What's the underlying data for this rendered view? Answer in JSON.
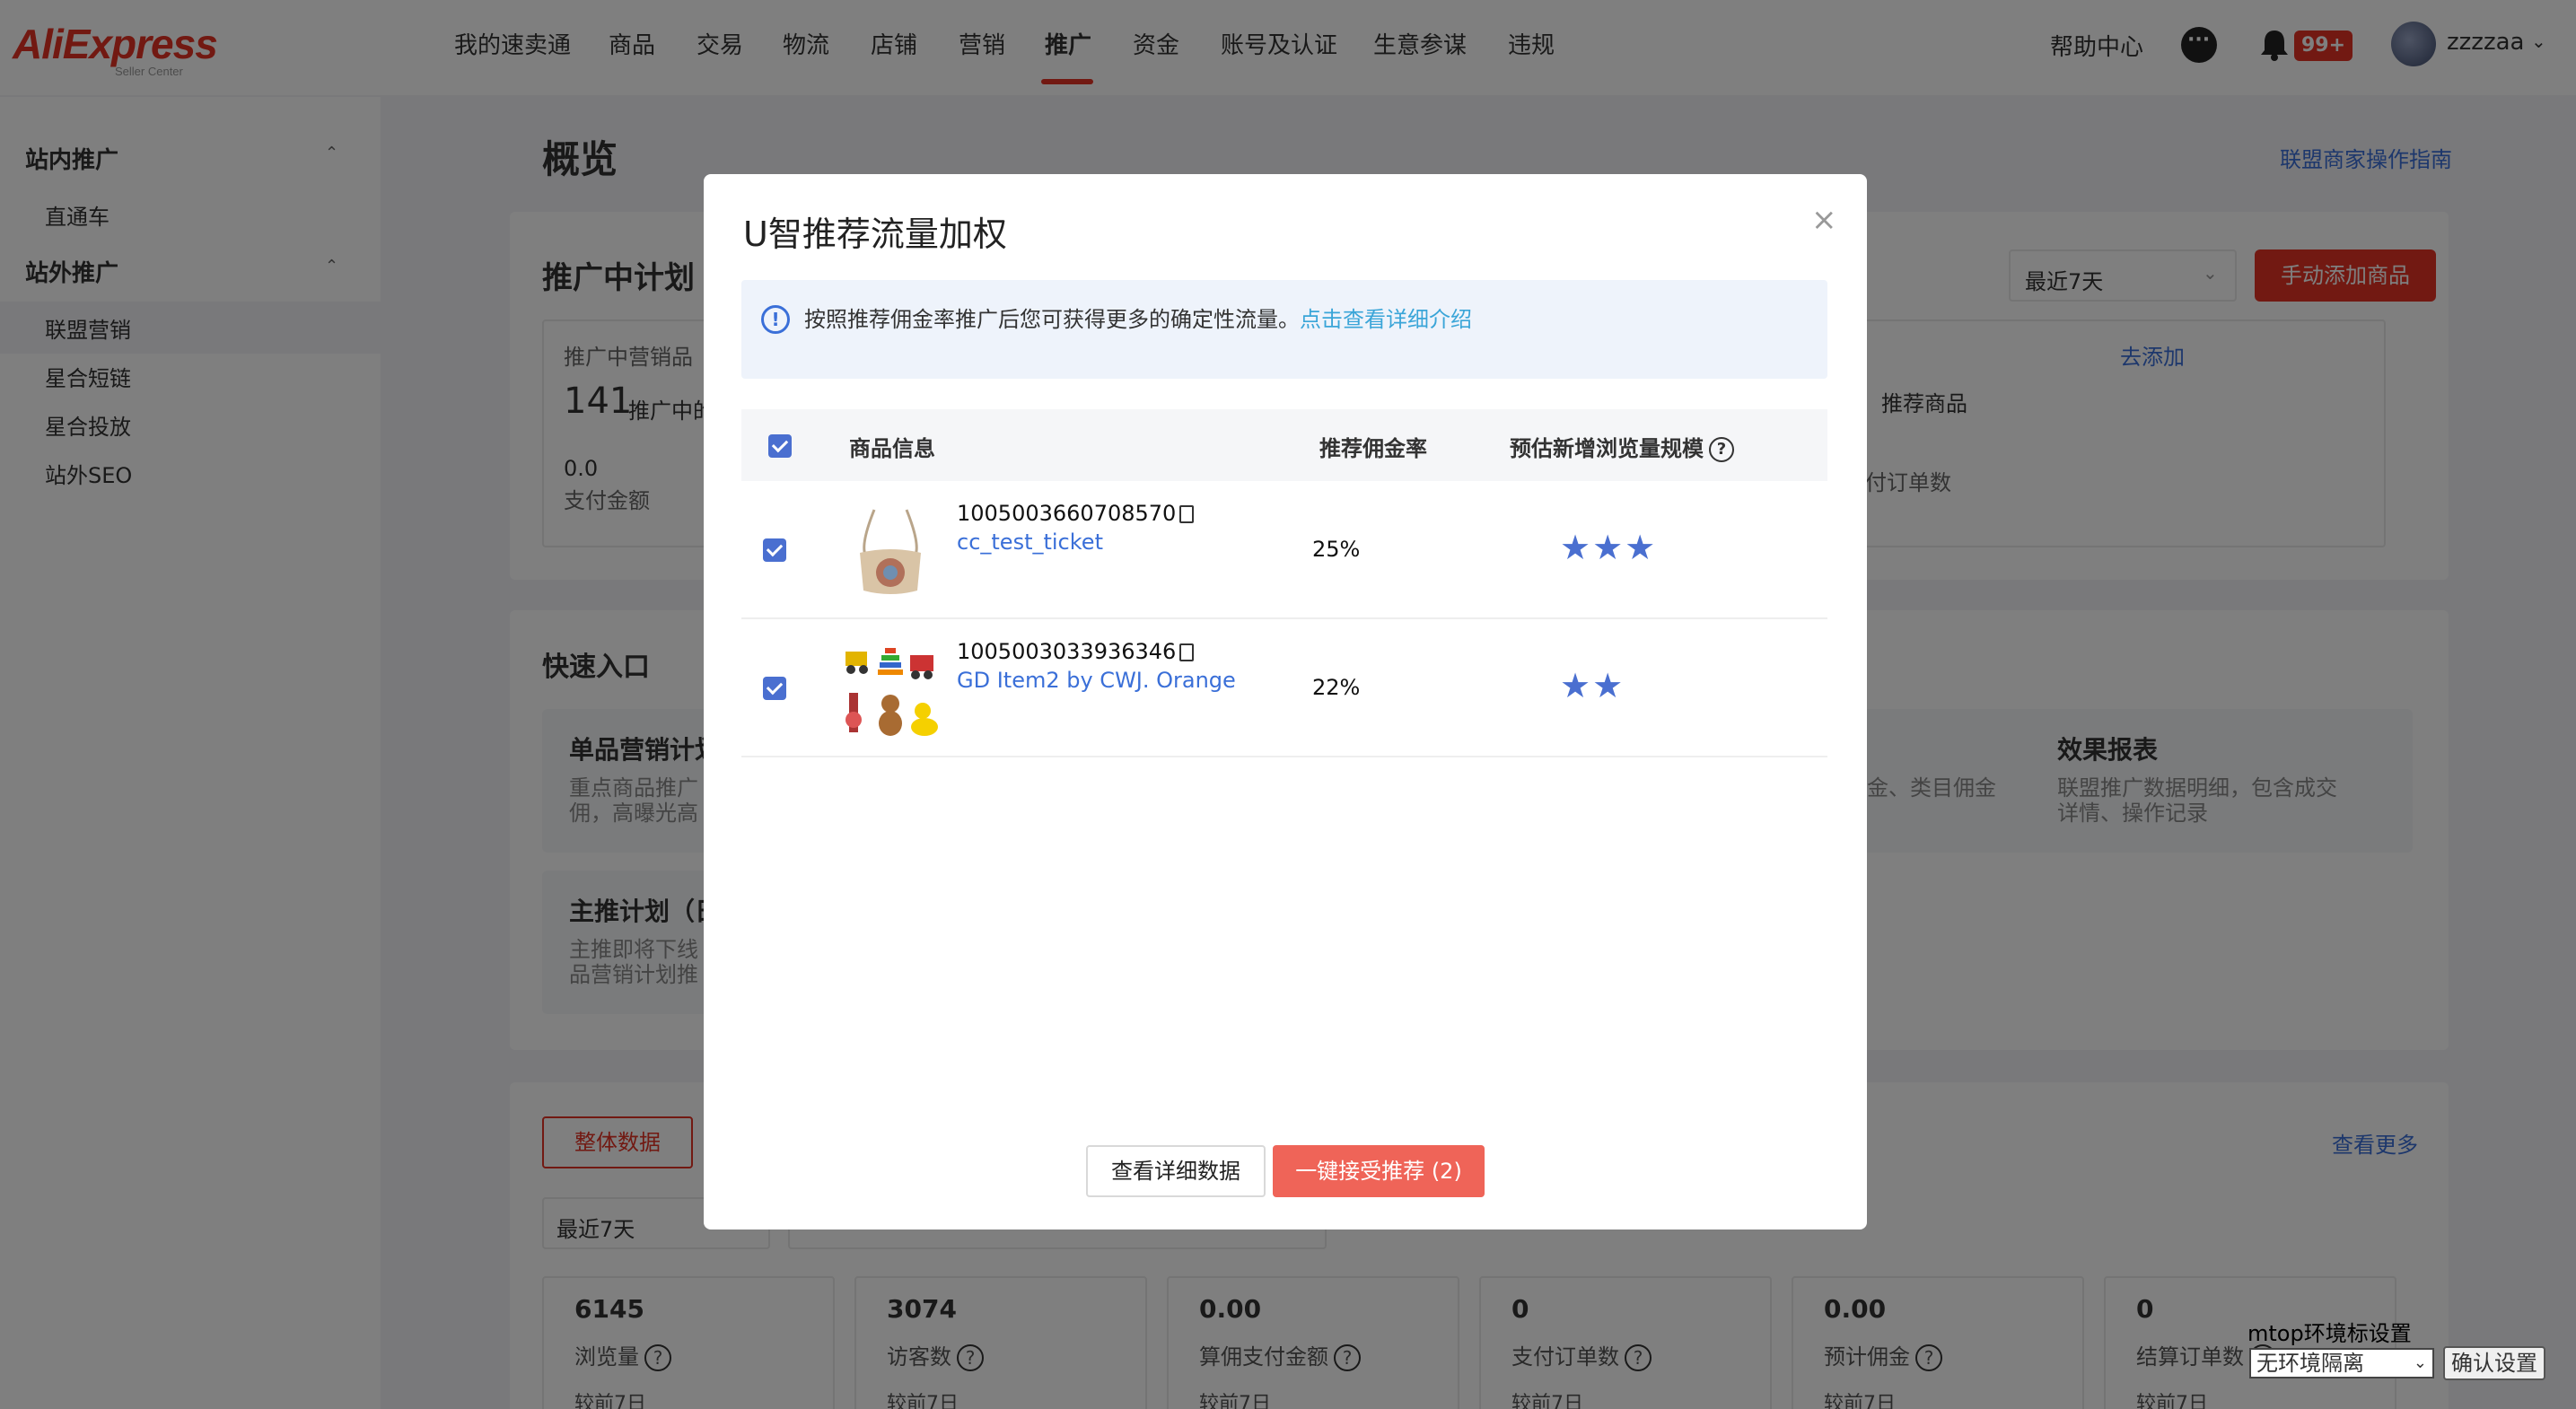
{
  "brand": {
    "logo_text": "AliExpress",
    "logo_sub": "Seller Center"
  },
  "nav": {
    "items": [
      "我的速卖通",
      "商品",
      "交易",
      "物流",
      "店铺",
      "营销",
      "推广",
      "资金",
      "账号及认证",
      "生意参谋",
      "违规"
    ],
    "active": "推广",
    "help": "帮助中心",
    "notification_badge": "99+",
    "username": "zzzzaa"
  },
  "sidebar": {
    "groups": [
      {
        "label": "站内推广",
        "items": [
          "直通车"
        ]
      },
      {
        "label": "站外推广",
        "items": [
          "联盟营销",
          "星合短链",
          "星合投放",
          "站外SEO"
        ]
      }
    ],
    "active_item": "联盟营销"
  },
  "page": {
    "title": "概览",
    "guide_link": "联盟商家操作指南",
    "promo": {
      "title": "推广中计划",
      "range_select": "最近7天",
      "add_button": "手动添加商品",
      "stat_label": "推广中营销品",
      "stat_value": "141",
      "stat_suffix": "推广中的",
      "pay_value": "0.0",
      "pay_label": "支付金额",
      "add_link": "去添加",
      "recommend_label": "推荐商品",
      "paid_orders_label": "付订单数"
    },
    "quick": {
      "title": "快速入口",
      "cards": [
        {
          "title": "单品营销计划",
          "desc1": "重点商品推广",
          "desc2": "佣，高曝光高"
        },
        {
          "title": "主推计划（日",
          "desc1": "主推即将下线",
          "desc2": "品营销计划推"
        },
        {
          "title": "",
          "desc1": "金、类目佣金",
          "desc2": ""
        },
        {
          "title": "效果报表",
          "desc1": "联盟推广数据明细，包含成交",
          "desc2": "详情、操作记录"
        }
      ]
    },
    "data": {
      "tab_active": "整体数据",
      "view_more": "查看更多",
      "range_select": "最近7天",
      "stats": [
        {
          "value": "6145",
          "label": "浏览量",
          "compare": "较前7日"
        },
        {
          "value": "3074",
          "label": "访客数",
          "compare": "较前7日"
        },
        {
          "value": "0.00",
          "label": "算佣支付金额",
          "compare": "较前7日"
        },
        {
          "value": "0",
          "label": "支付订单数",
          "compare": "较前7日"
        },
        {
          "value": "0.00",
          "label": "预计佣金",
          "compare": "较前7日"
        },
        {
          "value": "0",
          "label": "结算订单数",
          "compare": "较前7日"
        }
      ]
    }
  },
  "dev": {
    "label": "mtop环境标设置",
    "select_value": "无环境隔离",
    "confirm": "确认设置"
  },
  "modal": {
    "title": "U智推荐流量加权",
    "info_text": "按照推荐佣金率推广后您可获得更多的确定性流量。",
    "info_link": "点击查看详细介绍",
    "columns": [
      "商品信息",
      "推荐佣金率",
      "预估新增浏览量规模"
    ],
    "rows": [
      {
        "id": "1005003660708570",
        "name": "cc_test_ticket",
        "rate": "25%",
        "stars": 3,
        "stars_text": "★★★"
      },
      {
        "id": "1005003033936346",
        "name": "GD Item2 by CWJ. Orange",
        "rate": "22%",
        "stars": 2,
        "stars_text": "★★"
      }
    ],
    "btn_detail": "查看详细数据",
    "btn_accept": "一键接受推荐 (2)"
  }
}
